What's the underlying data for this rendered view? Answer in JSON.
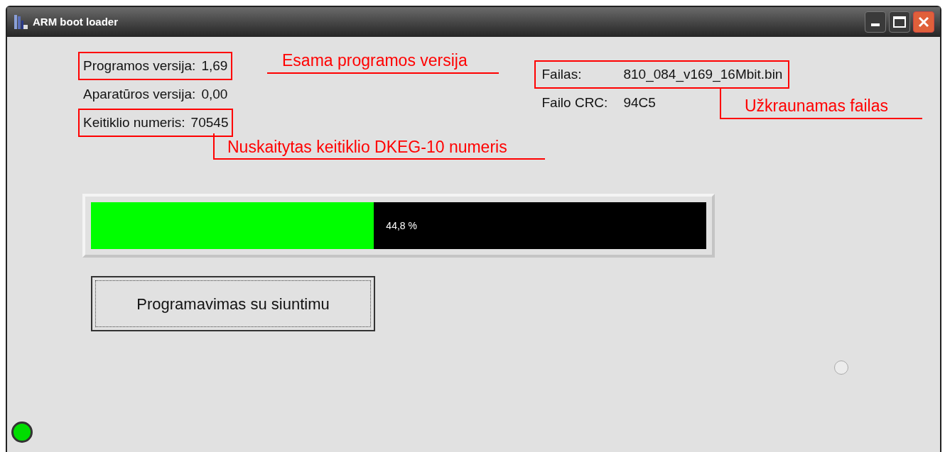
{
  "window": {
    "title": "ARM boot loader"
  },
  "info_left": [
    {
      "label": "Programos versija:",
      "value": "1,69",
      "highlighted": true
    },
    {
      "label": "Aparatūros versija:",
      "value": "0,00",
      "highlighted": false
    },
    {
      "label": "Keitiklio numeris:",
      "value": "70545",
      "highlighted": true
    }
  ],
  "info_right": [
    {
      "label": "Failas:",
      "value": "810_084_v169_16Mbit.bin",
      "highlighted": true
    },
    {
      "label": "Failo CRC:",
      "value": "94C5",
      "highlighted": false
    }
  ],
  "annotations": [
    "Esama programos versija",
    "Nuskaitytas keitiklio DKEG-10 numeris",
    "Užkraunamas failas"
  ],
  "progress": {
    "level": 0.46,
    "reading": "44,8 %"
  },
  "button": "Programavimas su siuntimu",
  "radio": {
    "checked": false
  },
  "status_led": {
    "on": true
  }
}
